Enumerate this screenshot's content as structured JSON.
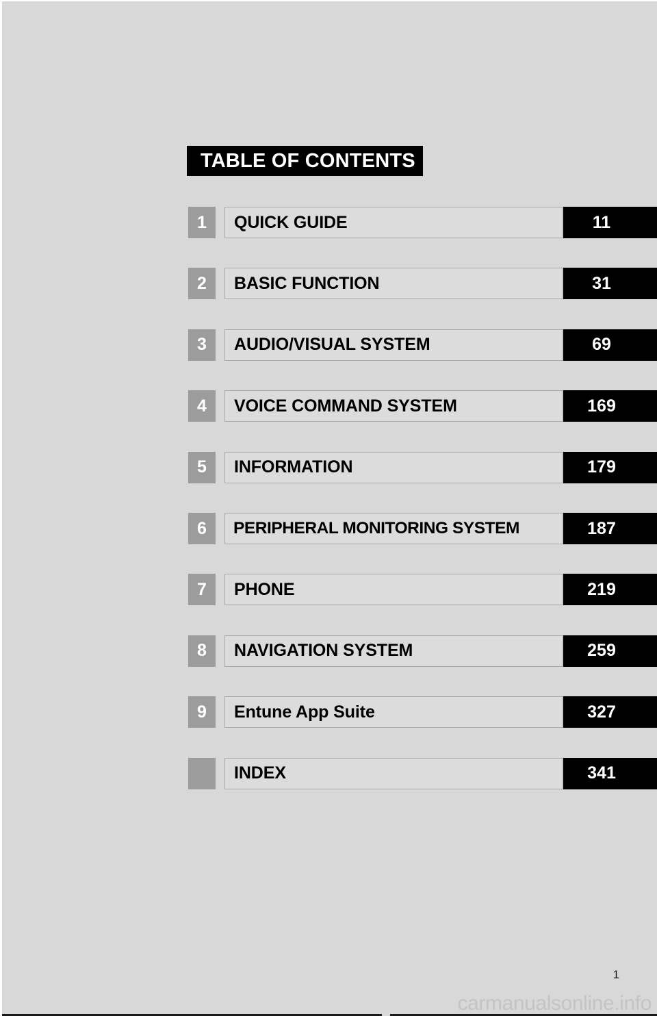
{
  "header": {
    "title": "TABLE OF CONTENTS"
  },
  "contents": {
    "rows": [
      {
        "number": "1",
        "title": "QUICK GUIDE",
        "page": "11"
      },
      {
        "number": "2",
        "title": "BASIC FUNCTION",
        "page": "31"
      },
      {
        "number": "3",
        "title": "AUDIO/VISUAL SYSTEM",
        "page": "69"
      },
      {
        "number": "4",
        "title": "VOICE COMMAND SYSTEM",
        "page": "169"
      },
      {
        "number": "5",
        "title": "INFORMATION",
        "page": "179"
      },
      {
        "number": "6",
        "title": "PERIPHERAL MONITORING SYSTEM",
        "page": "187"
      },
      {
        "number": "7",
        "title": "PHONE",
        "page": "219"
      },
      {
        "number": "8",
        "title": "NAVIGATION SYSTEM",
        "page": "259"
      },
      {
        "number": "9",
        "title": "Entune App Suite",
        "page": "327"
      },
      {
        "number": "",
        "title": "INDEX",
        "page": "341"
      }
    ]
  },
  "footer": {
    "folio": "1",
    "watermark": "carmanualsonline.info"
  },
  "colors": {
    "page_background": "#d8d8d8",
    "number_box": "#9c9c9c",
    "title_box": "#dcdcdc",
    "title_box_border": "#a9a9a9",
    "page_box": "#000000",
    "header_banner": "#000000",
    "watermark_text": "#c4c4c4"
  }
}
